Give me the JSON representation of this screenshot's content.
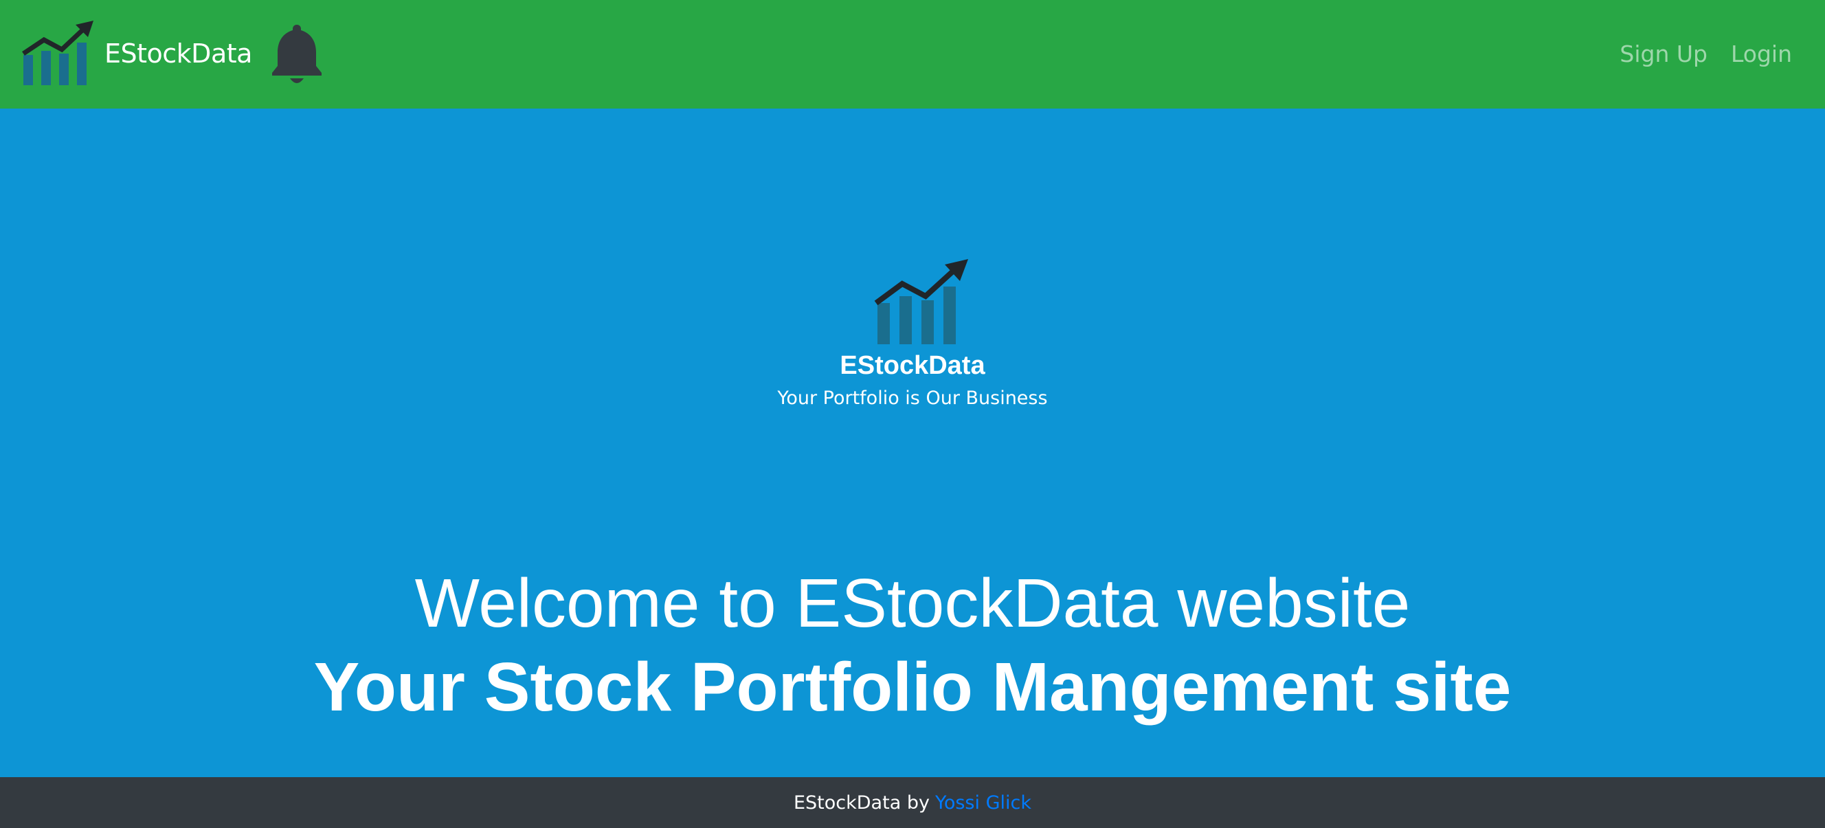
{
  "navbar": {
    "brand_name": "EStockData",
    "logo_icon": "rising-bar-chart-icon",
    "notification_icon": "bell-icon",
    "links": [
      "Sign Up",
      "Login"
    ]
  },
  "hero": {
    "logo_icon": "rising-bar-chart-icon",
    "brand_name": "EStockData",
    "tagline": "Your Portfolio is Our Business",
    "welcome_line": "Welcome to EStockData website",
    "headline": "Your Stock Portfolio Mangement site"
  },
  "footer": {
    "prefix": "EStockData by",
    "author": "Yossi Glick"
  },
  "colors": {
    "navbar_bg": "#28a745",
    "page_bg": "#0d95d5",
    "footer_bg": "#343a40",
    "logo_bars": "#1a6e8e",
    "logo_arrow": "#212529",
    "bell": "#343a40",
    "author_link": "#007bff"
  }
}
